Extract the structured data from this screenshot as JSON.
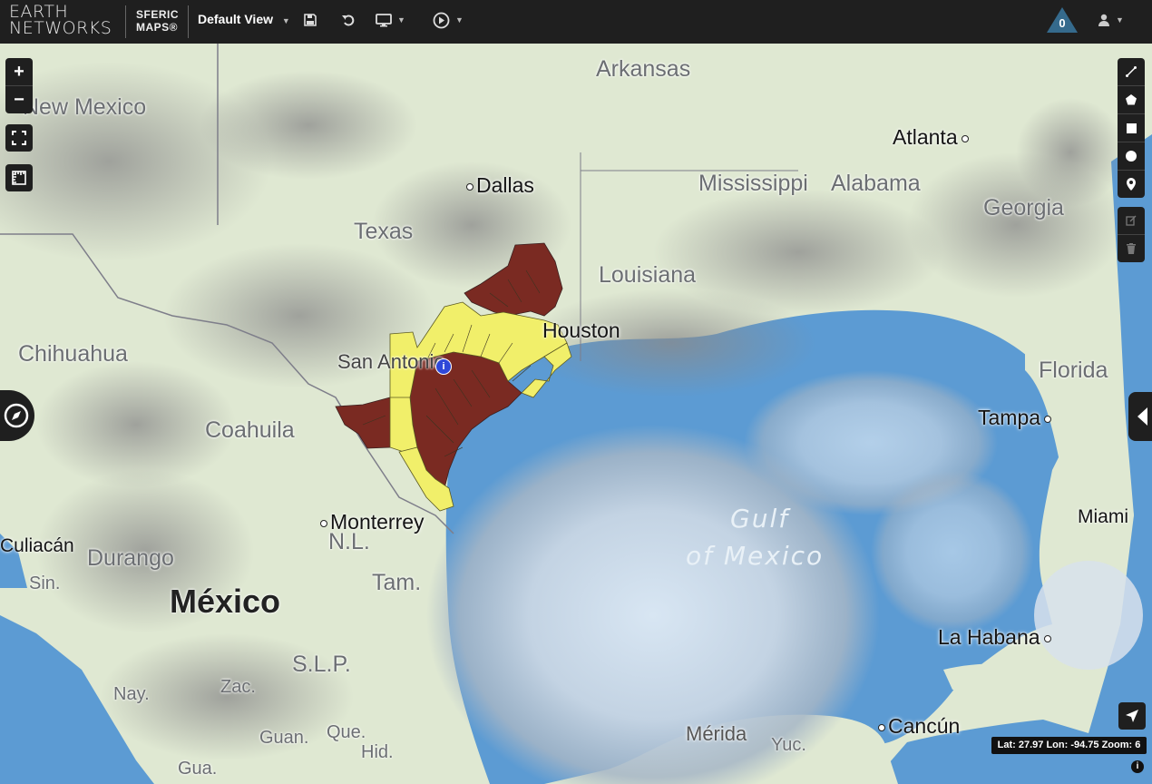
{
  "header": {
    "brand_line1": "EARTH",
    "brand_line2": "NETWORKS",
    "product_line1": "SFERIC",
    "product_line2": "MAPS®",
    "view_label": "Default View",
    "alert_count": "0",
    "icons": [
      "save-icon",
      "undo-icon",
      "monitor-icon",
      "play-icon",
      "user-icon"
    ]
  },
  "map": {
    "state_labels": [
      "New Mexico",
      "Arkansas",
      "Texas",
      "Louisiana",
      "Mississippi",
      "Alabama",
      "Georgia",
      "Florida",
      "Chihuahua",
      "Coahuila",
      "Durango",
      "Sin.",
      "N.L.",
      "Tam.",
      "S.L.P.",
      "Nay.",
      "Zac.",
      "Guan.",
      "Que.",
      "Hid.",
      "Gua.",
      "Yuc."
    ],
    "city_labels": [
      "Dallas",
      "Atlanta",
      "San Antonio",
      "Houston",
      "Tampa",
      "Monterrey",
      "Culiacán",
      "Miami",
      "La Habana",
      "Mérida",
      "Cancún"
    ],
    "country_label": "México",
    "water_label_line1": "Gulf",
    "water_label_line2": "of Mexico"
  },
  "controls": {
    "zoom_in": "+",
    "zoom_out": "−",
    "coords_text": "Lat: 27.97 Lon: -94.75 Zoom: 6",
    "info_marker": "i",
    "attribution": "i"
  },
  "colors": {
    "warning_red": "#7a2a22",
    "watch_yellow": "#f1ef6a",
    "land": "#dfe8d8",
    "water": "#5c9bd3",
    "topbar": "#1f1f1f"
  }
}
